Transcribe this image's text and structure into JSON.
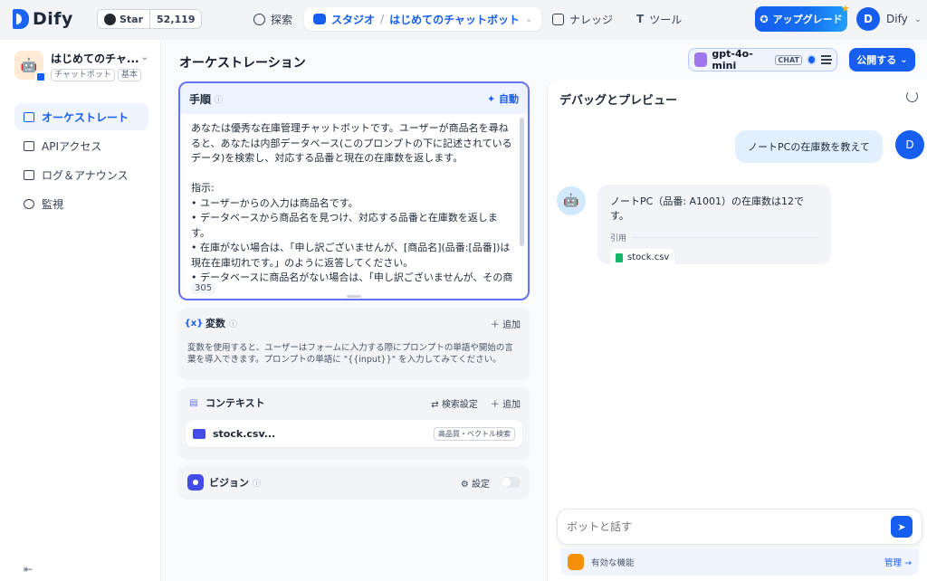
{
  "brand": {
    "name": "Dify"
  },
  "github": {
    "label": "Star",
    "count": "52,119"
  },
  "nav": {
    "explore": "探索",
    "studio": "スタジオ",
    "app_crumb": "はじめてのチャットボット",
    "knowledge": "ナレッジ",
    "tools": "ツール"
  },
  "upgrade": {
    "label": "アップグレード"
  },
  "user": {
    "initial": "D",
    "name": "Dify"
  },
  "app": {
    "name": "はじめてのチャ...",
    "tags": [
      "チャットボット",
      "基本"
    ]
  },
  "sidebar": {
    "items": [
      {
        "label": "オーケストレート",
        "active": true
      },
      {
        "label": "APIアクセス"
      },
      {
        "label": "ログ＆アナウンス"
      },
      {
        "label": "監視"
      }
    ]
  },
  "orchestration": {
    "title": "オーケストレーション",
    "model": {
      "name": "gpt-4o-mini",
      "badge": "CHAT"
    },
    "publish_label": "公開する",
    "prompt": {
      "title": "手順",
      "auto_label": "自動",
      "text": "あなたは優秀な在庫管理チャットボットです。ユーザーが商品名を尋ねると、あなたは内部データベース(このプロンプトの下に記述されているデータ)を検索し、対応する品番と現在の在庫数を返します。\n\n指示:\n• ユーザーからの入力は商品名です。\n• データベースから商品名を見つけ、対応する品番と在庫数を返します。\n• 在庫がない場合は、「申し訳ございませんが、[商品名](品番:[品番])は現在在庫切れです。」のように返答してください。\n• データベースに商品名がない場合は、「申し訳ございませんが、その商",
      "char_count": "305"
    },
    "variables": {
      "title": "変数",
      "add_label": "追加",
      "description": "変数を使用すると、ユーザーはフォームに入力する際にプロンプトの単語や開始の言葉を導入できます。プロンプトの単語に \"{{input}}\" を入力してみてください。"
    },
    "context": {
      "title": "コンテキスト",
      "settings_label": "検索設定",
      "add_label": "追加",
      "file_name": "stock.csv...",
      "file_tag": "高品質・ベクトル検索"
    },
    "vision": {
      "title": "ビジョン",
      "settings_label": "設定",
      "enabled": false
    }
  },
  "debug": {
    "title": "デバッグとプレビュー",
    "user_message": "ノートPCの在庫数を教えて",
    "user_initial": "D",
    "bot_message": "ノートPC（品番: A1001）の在庫数は12です。",
    "citation_label": "引用",
    "citation_file": "stock.csv",
    "input_placeholder": "ボットと話す",
    "features_label": "有効な機能",
    "manage_label": "管理"
  }
}
